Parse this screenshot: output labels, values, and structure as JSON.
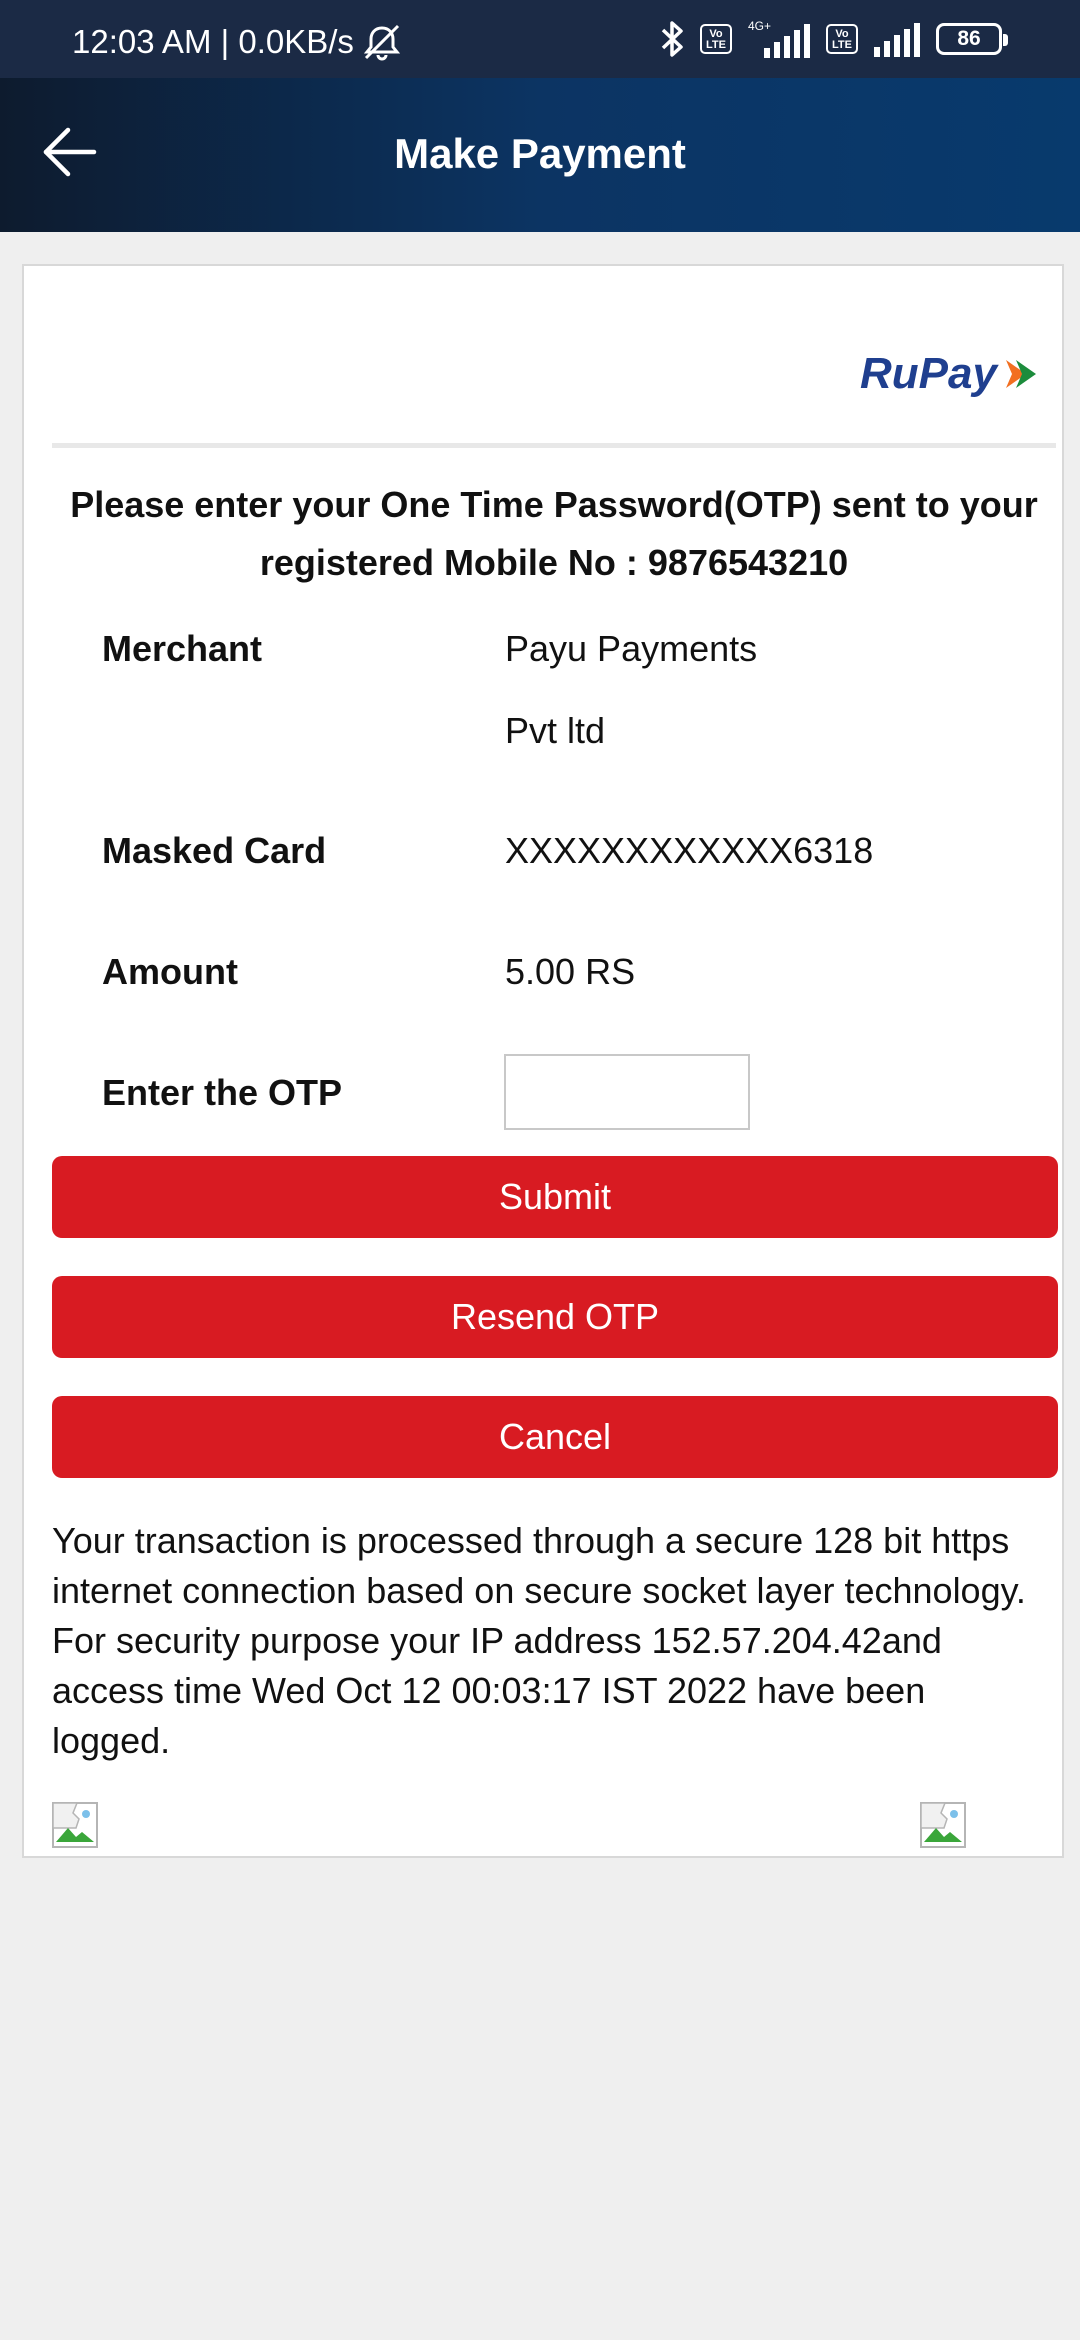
{
  "status_bar": {
    "time_speed": "12:03 AM | 0.0KB/s",
    "network_4g": "4G+",
    "volte_label": "Vo LTE",
    "battery": "86"
  },
  "app_bar": {
    "title": "Make Payment",
    "back_icon": "arrow-left-icon"
  },
  "card": {
    "logo_text": "RuPay",
    "otp_heading_line1": "Please enter your One Time Password(OTP) sent to your",
    "otp_heading_line2": "registered Mobile No : 9876543210",
    "merchant_label": "Merchant",
    "merchant_value_line1": "Payu Payments",
    "merchant_value_line2": "Pvt ltd",
    "masked_card_label": "Masked Card",
    "masked_card_value": "XXXXXXXXXXXX6318",
    "amount_label": "Amount",
    "amount_value": "5.00 RS",
    "otp_label": "Enter the OTP",
    "otp_value": "",
    "submit_label": "Submit",
    "resend_label": "Resend OTP",
    "cancel_label": "Cancel",
    "secure_text": "Your transaction is processed through a secure 128 bit https internet connection based on secure socket layer technology. For security purpose your IP address 152.57.204.42and access time Wed Oct 12 00:03:17 IST 2022 have been logged."
  },
  "colors": {
    "primary_red": "#d81b22",
    "appbar_dark": "#0d1b2e",
    "appbar_blue": "#083a6d",
    "rupay_blue": "#1f3f8f",
    "rupay_orange": "#f26f21",
    "rupay_green": "#1c8c3c"
  }
}
